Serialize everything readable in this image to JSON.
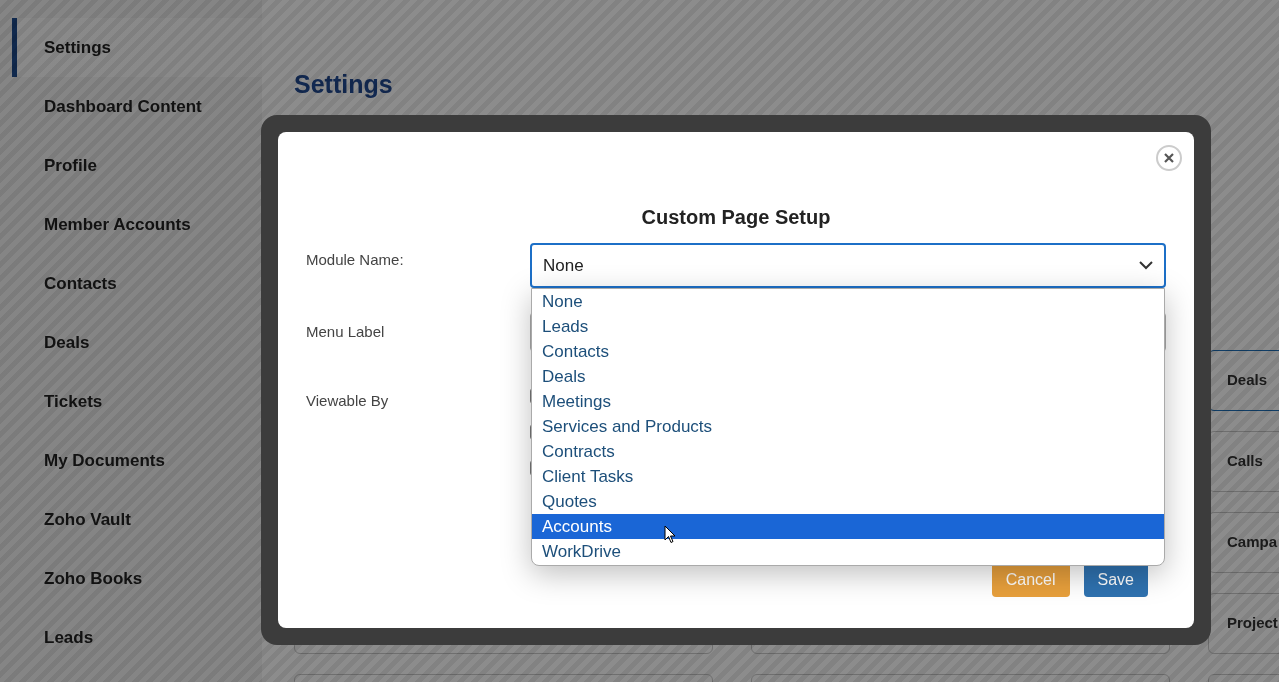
{
  "sidebar": {
    "items": [
      {
        "label": "Settings",
        "selected": true
      },
      {
        "label": "Dashboard Content",
        "selected": false
      },
      {
        "label": "Profile",
        "selected": false
      },
      {
        "label": "Member Accounts",
        "selected": false
      },
      {
        "label": "Contacts",
        "selected": false
      },
      {
        "label": "Deals",
        "selected": false
      },
      {
        "label": "Tickets",
        "selected": false
      },
      {
        "label": "My Documents",
        "selected": false
      },
      {
        "label": "Zoho Vault",
        "selected": false
      },
      {
        "label": "Zoho Books",
        "selected": false
      },
      {
        "label": "Leads",
        "selected": false
      }
    ]
  },
  "page_title": "Settings",
  "module_cards": [
    {
      "label": "Deals",
      "selected": true
    },
    {
      "label": "Calls",
      "selected": false
    },
    {
      "label": "Campa",
      "selected": false
    },
    {
      "label": "Project",
      "selected": false
    }
  ],
  "dialog": {
    "title": "Custom Page Setup",
    "fields": [
      {
        "kind": "select",
        "label": "Module Name:",
        "value": "None"
      },
      {
        "kind": "text",
        "label": "Menu Label"
      },
      {
        "kind": "checkboxes",
        "label": "Viewable By"
      }
    ],
    "dropdown_options": [
      {
        "label": "None",
        "selected": false
      },
      {
        "label": "Leads",
        "selected": false
      },
      {
        "label": "Contacts",
        "selected": false
      },
      {
        "label": "Deals",
        "selected": false
      },
      {
        "label": "Meetings",
        "selected": false
      },
      {
        "label": "Services and Products",
        "selected": false
      },
      {
        "label": "Contracts",
        "selected": false
      },
      {
        "label": "Client Tasks",
        "selected": false
      },
      {
        "label": "Quotes",
        "selected": false
      },
      {
        "label": "Accounts",
        "selected": true
      },
      {
        "label": "WorkDrive",
        "selected": false
      }
    ],
    "buttons": [
      {
        "kind": "cancel",
        "label": "Cancel"
      },
      {
        "kind": "save",
        "label": "Save"
      }
    ]
  }
}
